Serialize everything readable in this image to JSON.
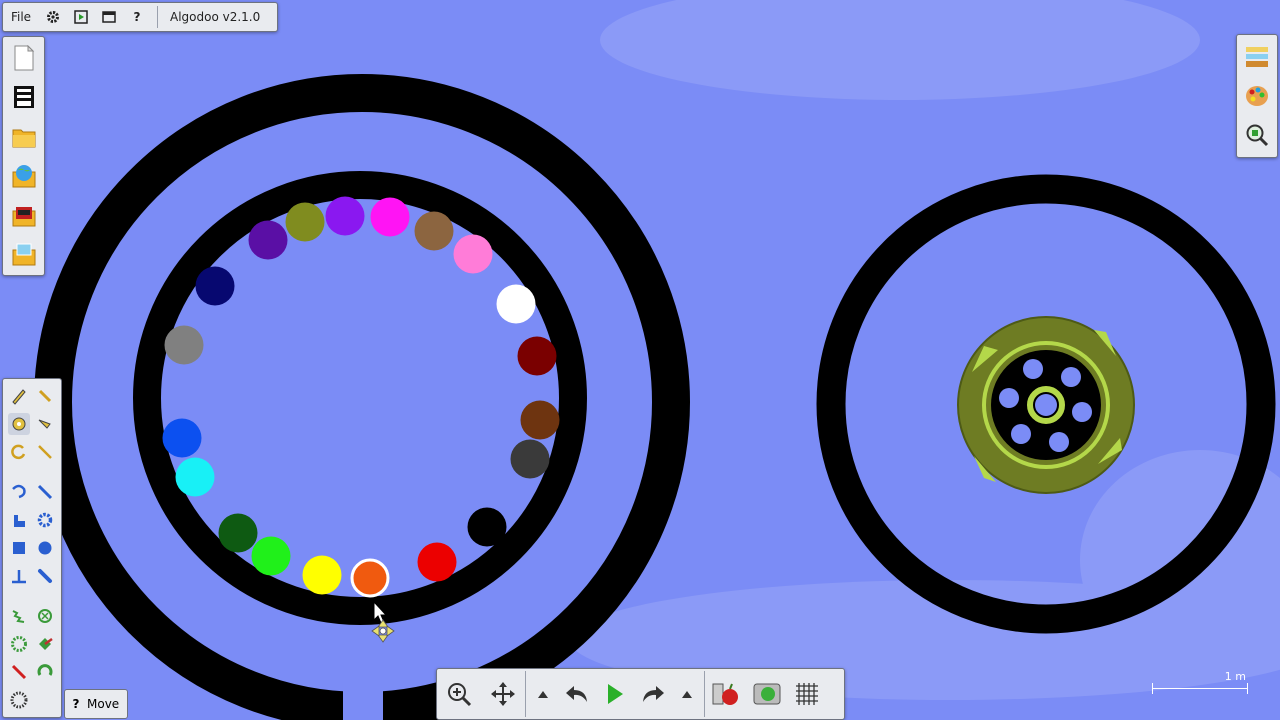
{
  "menu": {
    "file_label": "File",
    "app_title": "Algodoo v2.1.0"
  },
  "hint": {
    "tool_label": "Move"
  },
  "scale": {
    "label": "1 m"
  },
  "left_toolbar_top": [
    "new-scene",
    "blank-scene",
    "open-folder",
    "world-browse",
    "photo-album",
    "scene-gallery"
  ],
  "left_toolbar_tools": [
    "sketch",
    "brush",
    "move",
    "drag",
    "rotate",
    "scale",
    "rope",
    "knife",
    "grab",
    "gear",
    "box",
    "circle",
    "plane",
    "chain",
    "spring",
    "hinge",
    "fixate",
    "thruster",
    "laser",
    "tracer",
    "eraser",
    "texture"
  ],
  "right_toolbar": [
    "materials",
    "appearance",
    "zoom-inspect"
  ],
  "bottom_toolbar": [
    "zoom",
    "pan",
    "undo-arrow",
    "undo",
    "play",
    "redo",
    "redo-arrow",
    "material-fruit",
    "liquify",
    "grid"
  ],
  "colors": {
    "background": "#7b8cf6",
    "ring": "#000000",
    "wheel": "#6e7c23",
    "wheel_accent": "#b4d84a"
  },
  "balls": [
    {
      "name": "purple",
      "color": "#5a0fa5"
    },
    {
      "name": "olive",
      "color": "#808c1f"
    },
    {
      "name": "violet",
      "color": "#8a18f0"
    },
    {
      "name": "magenta",
      "color": "#ff14f4"
    },
    {
      "name": "brown",
      "color": "#8c6540"
    },
    {
      "name": "pink",
      "color": "#ff7cd8"
    },
    {
      "name": "white",
      "color": "#ffffff"
    },
    {
      "name": "dark-red",
      "color": "#7a0000"
    },
    {
      "name": "dark-brown",
      "color": "#6e3410"
    },
    {
      "name": "charcoal",
      "color": "#3a3a3a"
    },
    {
      "name": "black",
      "color": "#000000"
    },
    {
      "name": "red",
      "color": "#ec0000"
    },
    {
      "name": "orange",
      "color": "#f05a0f"
    },
    {
      "name": "yellow",
      "color": "#ffff00"
    },
    {
      "name": "lime",
      "color": "#20f01a"
    },
    {
      "name": "dark-green",
      "color": "#0e5a12"
    },
    {
      "name": "cyan",
      "color": "#18f0f6"
    },
    {
      "name": "blue",
      "color": "#0c50f0"
    },
    {
      "name": "gray",
      "color": "#808080"
    },
    {
      "name": "navy",
      "color": "#070870"
    }
  ]
}
